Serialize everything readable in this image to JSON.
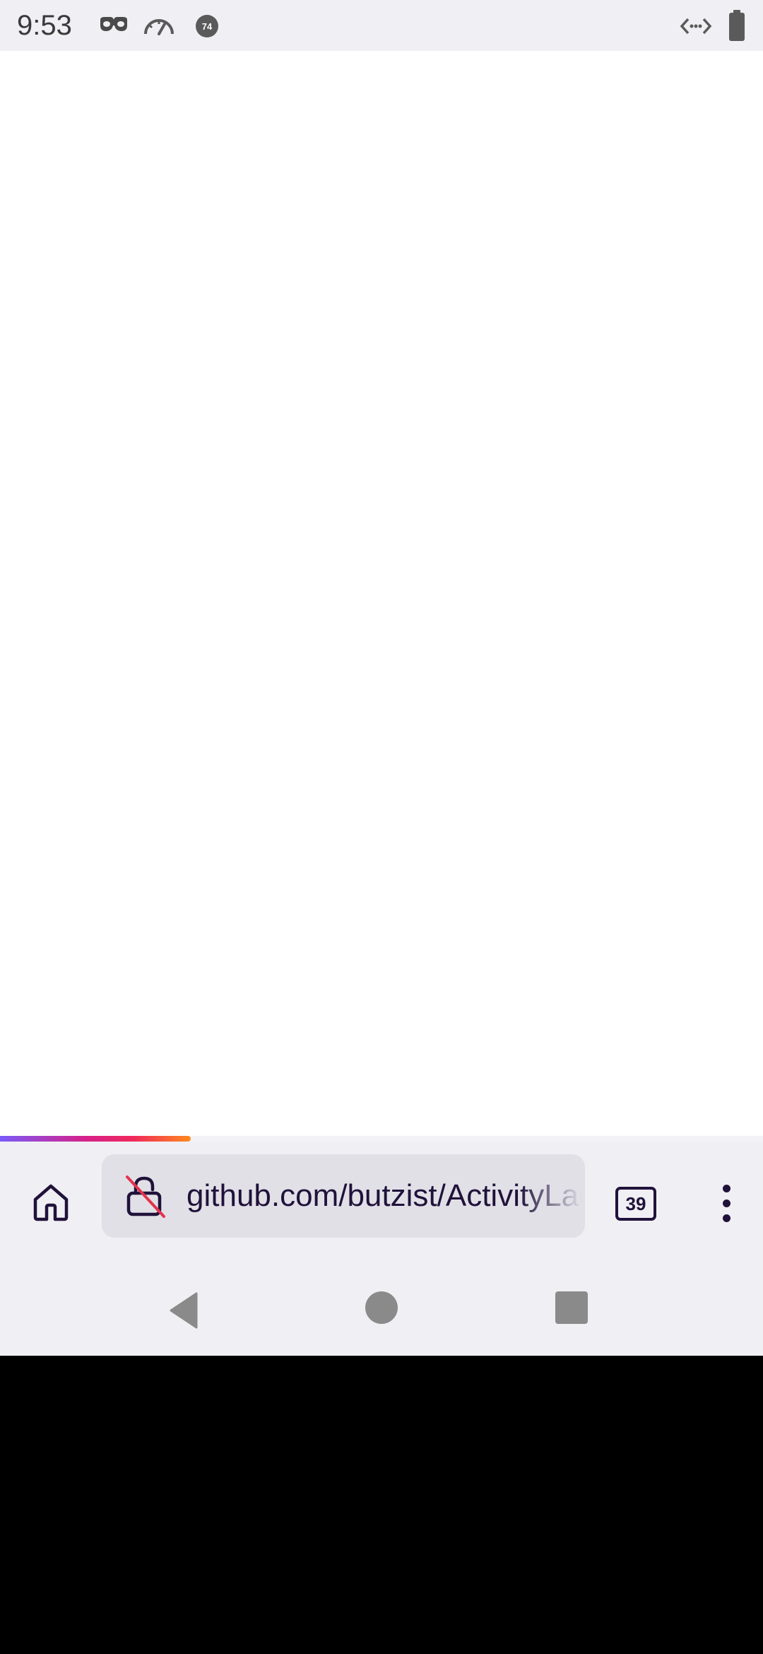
{
  "status_bar": {
    "time": "9:53",
    "notification_badge": "74",
    "icons": [
      "incognito-mask-icon",
      "speedometer-icon",
      "notification-badge-icon",
      "data-saver-icon",
      "battery-icon"
    ]
  },
  "page_load_progress": 0.25,
  "toolbar": {
    "home_icon": "home-icon",
    "security_icon": "insecure-lock-icon",
    "url": "github.com/butzist/ActivityLauncher",
    "tab_count": "39",
    "menu_icon": "kebab-menu-icon"
  },
  "nav_bar": {
    "icons": [
      "back-triangle-icon",
      "home-circle-icon",
      "recents-square-icon"
    ]
  },
  "colors": {
    "chrome_bg": "#f0eff4",
    "url_bar_bg": "#e1e0e7",
    "ink": "#20123a",
    "progress_gradient": [
      "#7a5af8",
      "#d6208a",
      "#ff8a1e"
    ],
    "insecure_slash": "#e2344d"
  }
}
